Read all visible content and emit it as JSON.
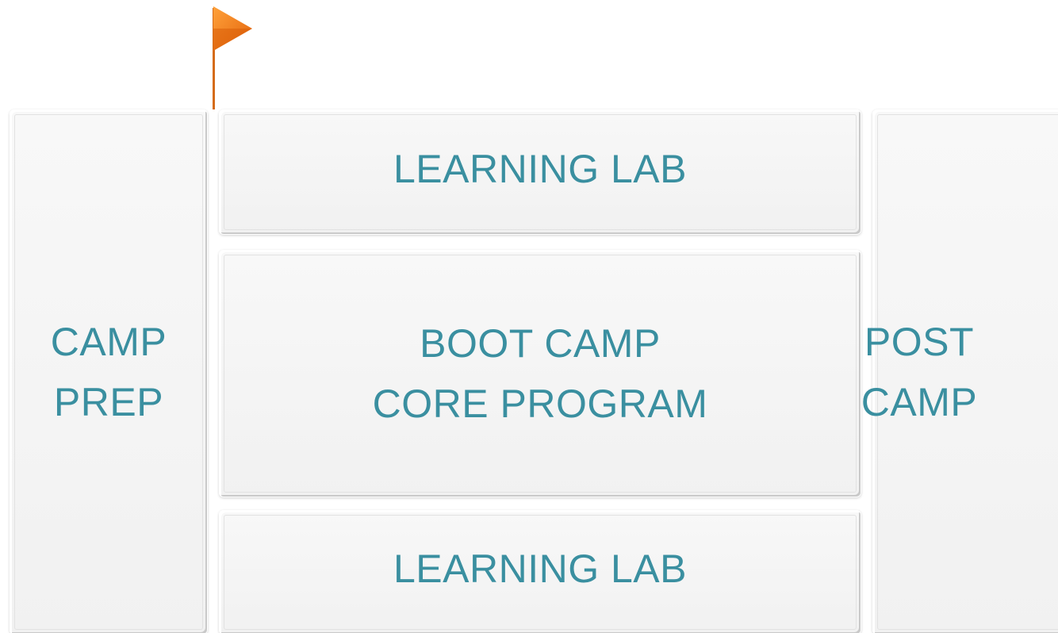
{
  "flag": {
    "icon": "flag-icon",
    "color": "#f07a12"
  },
  "blocks": {
    "camp_prep": {
      "line1": "CAMP",
      "line2": "PREP"
    },
    "lab_top": {
      "line1": "LEARNING LAB"
    },
    "core": {
      "line1": "BOOT CAMP",
      "line2": "CORE PROGRAM"
    },
    "lab_bottom": {
      "line1": "LEARNING LAB"
    },
    "post_camp": {
      "line1": "POST",
      "line2": "CAMP"
    }
  },
  "colors": {
    "text": "#3a8fa0",
    "box": "#f4f4f4"
  }
}
